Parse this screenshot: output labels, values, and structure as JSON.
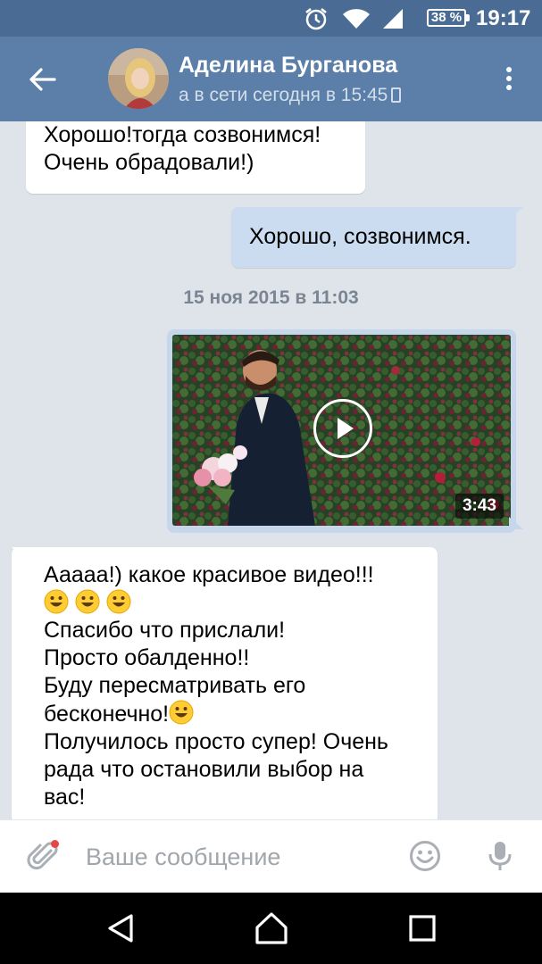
{
  "status_bar": {
    "battery": "38 %",
    "time": "19:17",
    "icons": [
      "alarm-icon",
      "wifi-icon",
      "signal-icon",
      "battery-icon"
    ]
  },
  "header": {
    "contact_name": "Аделина Бурганова",
    "status": "а в сети сегодня в 15:45",
    "icons": [
      "back-arrow-icon",
      "phone-icon",
      "more-vertical-icon"
    ]
  },
  "messages": {
    "msg1": {
      "lines": [
        "Хорошо!тогда созвонимся!",
        "Очень обрадовали!)"
      ]
    },
    "msg2": {
      "text": "Хорошо,  созвонимся."
    },
    "date_separator": "15 ноя 2015 в 11:03",
    "video": {
      "duration": "3:43"
    },
    "msg3": {
      "line1": "Ааааа!) какое красивое видео!!!",
      "line3": "Спасибо что прислали!",
      "line4": "Просто обалденно!!",
      "line5": "Буду пересматривать его",
      "line6": "бесконечно!",
      "line7": "Получилось просто супер! Очень",
      "line8": "рада что остановили выбор на",
      "line9": "вас!"
    }
  },
  "input_bar": {
    "placeholder": "Ваше сообщение",
    "icons": [
      "paperclip-icon",
      "smiley-icon",
      "microphone-icon"
    ]
  },
  "nav_bar": {
    "icons": [
      "back-triangle-icon",
      "home-icon",
      "recents-square-icon"
    ]
  },
  "colors": {
    "header": "#5b7fa8",
    "status_bar": "#4a6c94",
    "chat_background": "#dfe4ea",
    "incoming_bubble": "#ffffff",
    "outgoing_bubble": "#ccdcf0",
    "notification_dot": "#e64646"
  }
}
